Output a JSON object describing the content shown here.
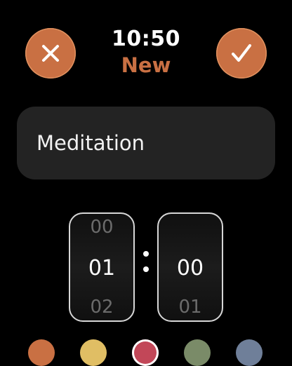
{
  "header": {
    "time": "10:50",
    "subtitle": "New"
  },
  "icons": {
    "cancel": "close-icon",
    "confirm": "checkmark-icon"
  },
  "name_field": {
    "value": "Meditation"
  },
  "duration_picker": {
    "hours": {
      "prev": "00",
      "current": "01",
      "next": "02"
    },
    "minutes": {
      "prev": "",
      "current": "00",
      "next": "01"
    }
  },
  "colors": {
    "accent": "#c97043",
    "swatches": [
      "#c97043",
      "#e0be64",
      "#c24758",
      "#7a8b68",
      "#6f7f99"
    ]
  }
}
